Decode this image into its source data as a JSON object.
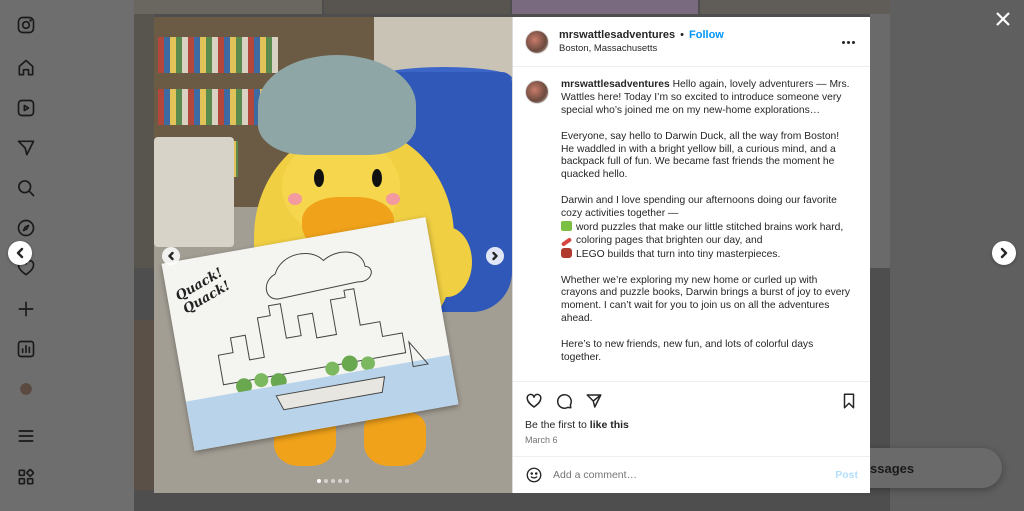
{
  "app": {
    "nav": [
      "instagram-icon",
      "home-icon",
      "reels-icon",
      "explore-icon",
      "search-icon",
      "compass-icon",
      "heart-icon",
      "create-icon",
      "dashboard-icon",
      "profile-icon",
      "menu-icon",
      "more-icon"
    ],
    "messages_label": "ssages"
  },
  "post": {
    "username": "mrswattlesadventures",
    "follow_label": "Follow",
    "separator": "•",
    "location": "Boston, Massachusetts",
    "card_text": "Quack! Quack!",
    "image_count": 5,
    "active_image": 0,
    "caption": {
      "intro": "Hello again, lovely adventurers — Mrs. Wattles here! Today I’m so excited to introduce someone very special who’s joined me on my new-home explorations…",
      "para2": "Everyone, say hello to Darwin Duck, all the way from Boston! He waddled in with a bright yellow bill, a curious mind, and a backpack full of fun. We became fast friends the moment he quacked hello.",
      "para3_intro": "Darwin and I love spending our afternoons doing our favorite cozy activities together —",
      "item1": "word puzzles that make our little stitched brains work hard,",
      "item2": "coloring pages that brighten our day, and",
      "item3": "LEGO builds that turn into tiny masterpieces.",
      "para4": "Whether we’re exploring my new home or curled up with crayons and puzzle books, Darwin brings a burst of joy to every moment. I can’t wait for you to join us on all the adventures ahead.",
      "para5": "Here’s to new friends, new fun, and lots of colorful days together."
    },
    "likes_prefix": "Be the first to ",
    "likes_action": "like this",
    "date": "March 6",
    "comment_placeholder": "Add a comment…",
    "post_label": "Post"
  },
  "colors": {
    "accent": "#0095f6",
    "post_disabled": "#b2dffc"
  }
}
